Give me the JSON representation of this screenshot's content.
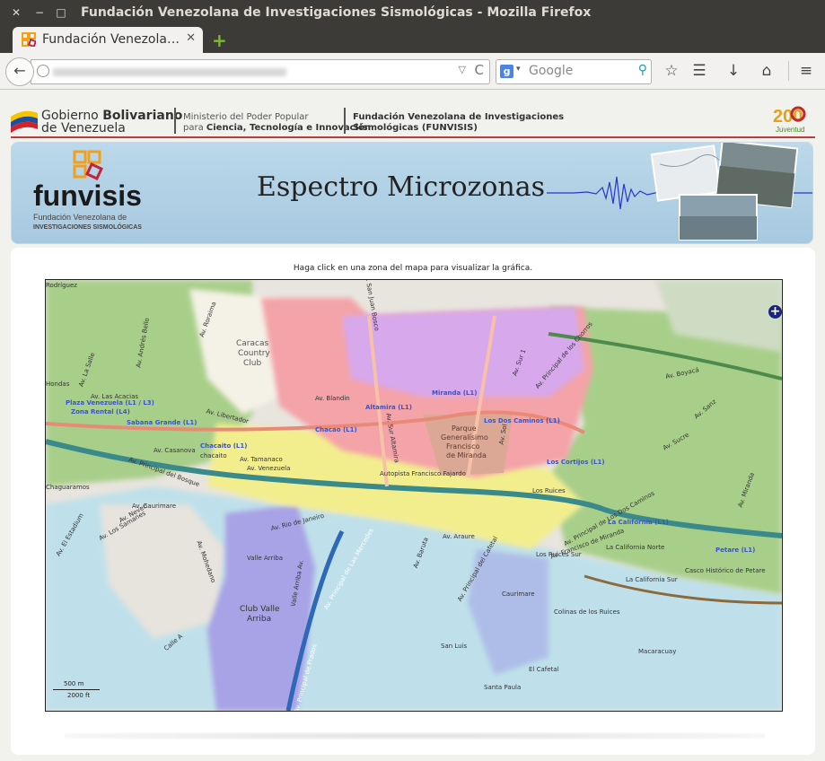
{
  "window": {
    "title": "Fundación Venezolana de Investigaciones Sismológicas - Mozilla Firefox",
    "close_glyph": "✕",
    "minimize_glyph": "−",
    "maximize_glyph": "□"
  },
  "tabs": [
    {
      "title": "Fundación Venezola…",
      "close_glyph": "✕",
      "icon": "funvisis-favicon"
    }
  ],
  "new_tab_glyph": "+",
  "navbar": {
    "back_glyph": "←",
    "url_dropdown_glyph": "▽",
    "reload_glyph": "C",
    "search_engine_letter": "g",
    "search_caret": "▾",
    "search_placeholder": "Google",
    "search_go_glyph": "⚲",
    "icons": [
      "star-icon",
      "reading-list-icon",
      "download-icon",
      "home-icon",
      "menu-icon"
    ],
    "icon_glyphs": {
      "star": "☆",
      "reading_list": "☰",
      "download": "↓",
      "home": "⌂",
      "menu": "≡"
    }
  },
  "gov_header": {
    "line1_a": "Gobierno ",
    "line1_b": "Bolivariano",
    "line2": "de Venezuela",
    "ministry_line1": "Ministerio del Poder Popular",
    "ministry_line2_a": "para ",
    "ministry_line2_b": "Ciencia, Tecnología e Innovación",
    "foundation_line1": "Fundación Venezolana de Investigaciones",
    "foundation_line2": "Sismológicas (FUNVISIS)",
    "juventud_number": "200",
    "juventud_text": "Juventud"
  },
  "banner": {
    "logo_word": "funvisis",
    "logo_sub1": "Fundación Venezolana de",
    "logo_sub2": "INVESTIGACIONES SISMOLÓGICAS",
    "title": "Espectro Microzonas"
  },
  "content": {
    "instructions": "Haga click en una zona del mapa para visualizar la gráfica."
  },
  "map": {
    "zoom_glyph": "+",
    "scale_metric": "500 m",
    "scale_imperial": "2000 ft",
    "colors": {
      "water_blue": "#bfe0ea",
      "green_zone": "#a8cf8a",
      "pink_zone": "#f4a3a8",
      "purple_zone": "#d7a8ec",
      "yellow_zone": "#f2ee8e",
      "violet_zone": "#a8a2e6",
      "gray_zone": "#e7e3dd"
    },
    "labels": [
      {
        "text": "Caracas",
        "cls": "place"
      },
      {
        "text": "Country",
        "cls": "place"
      },
      {
        "text": "Club",
        "cls": "place"
      },
      {
        "text": "Parque",
        "cls": "park"
      },
      {
        "text": "Generalísimo",
        "cls": "park"
      },
      {
        "text": "Francisco",
        "cls": "park"
      },
      {
        "text": "de Miranda",
        "cls": "park"
      },
      {
        "text": "Club Valle",
        "cls": "place"
      },
      {
        "text": "Arriba",
        "cls": "place"
      },
      {
        "text": "Altamira (L1)",
        "cls": "metro"
      },
      {
        "text": "Miranda (L1)",
        "cls": "metro"
      },
      {
        "text": "Los Dos Caminos (L1)",
        "cls": "metro"
      },
      {
        "text": "Chacao (L1)",
        "cls": "metro"
      },
      {
        "text": "Chacaito (L1)",
        "cls": "metro"
      },
      {
        "text": "Sabana Grande (L1)",
        "cls": "metro"
      },
      {
        "text": "Plaza Venezuela (L1 / L3)",
        "cls": "metro"
      },
      {
        "text": "Zona Rental (L4)",
        "cls": "metro"
      },
      {
        "text": "Los Cortijos (L1)",
        "cls": "metro"
      },
      {
        "text": "La California (L1)",
        "cls": "metro"
      },
      {
        "text": "Petare (L1)",
        "cls": "metro"
      },
      {
        "text": "Av. Blandin",
        "cls": "road"
      },
      {
        "text": "Av. Libertador",
        "cls": "road"
      },
      {
        "text": "Av. Tamanaco",
        "cls": "road"
      },
      {
        "text": "Av. Venezuela",
        "cls": "road"
      },
      {
        "text": "Av. Casanova",
        "cls": "road"
      },
      {
        "text": "Av. Boyacá",
        "cls": "road"
      },
      {
        "text": "Av. Sucre",
        "cls": "road"
      },
      {
        "text": "Av. Rio de Janeiro",
        "cls": "road"
      },
      {
        "text": "Av. Araure",
        "cls": "road"
      },
      {
        "text": "Av. Principal del Cafetal",
        "cls": "road"
      },
      {
        "text": "Autopista Francisco Fajardo",
        "cls": "road"
      },
      {
        "text": "Los Ruices",
        "cls": "place"
      },
      {
        "text": "Los Ruices Sur",
        "cls": "place"
      },
      {
        "text": "La California Norte",
        "cls": "place"
      },
      {
        "text": "La California Sur",
        "cls": "place"
      },
      {
        "text": "Casco Histórico de Petare",
        "cls": "place"
      },
      {
        "text": "Caurimare",
        "cls": "place"
      },
      {
        "text": "Colinas de los Ruices",
        "cls": "place"
      },
      {
        "text": "San Luis",
        "cls": "place"
      },
      {
        "text": "El Cafetal",
        "cls": "place"
      },
      {
        "text": "Santa Paula",
        "cls": "place"
      },
      {
        "text": "Macaracuay",
        "cls": "place"
      },
      {
        "text": "chacaito",
        "cls": "place"
      },
      {
        "text": "Chaguaramos",
        "cls": "place"
      },
      {
        "text": "Av. San Juan Bosco",
        "cls": "road"
      },
      {
        "text": "Av. Principal de los Chorros",
        "cls": "road"
      },
      {
        "text": "Av. Sur 1",
        "cls": "road"
      },
      {
        "text": "Av. Sur Altamira",
        "cls": "road"
      },
      {
        "text": "Av. Principal del Bosque",
        "cls": "road"
      },
      {
        "text": "Av. Roraima",
        "cls": "road"
      },
      {
        "text": "Av. Neveri",
        "cls": "road"
      },
      {
        "text": "Av. El Estadium",
        "cls": "road"
      },
      {
        "text": "Av. La Salle",
        "cls": "road"
      },
      {
        "text": "Av. Las Acacias",
        "cls": "road"
      },
      {
        "text": "Calle A",
        "cls": "road"
      },
      {
        "text": "Av. Los Samanes",
        "cls": "road"
      },
      {
        "text": "Av. Principal de Prados",
        "cls": "road"
      },
      {
        "text": "Av. Principal de Las Mercedes",
        "cls": "road"
      },
      {
        "text": "Valle Arriba",
        "cls": "road"
      },
      {
        "text": "Av. Caurimare",
        "cls": "road"
      },
      {
        "text": "Av. Sanz",
        "cls": "road"
      },
      {
        "text": "Av. Miranda",
        "cls": "road"
      },
      {
        "text": "Av. Andrés Bello",
        "cls": "road"
      },
      {
        "text": "Av. Francisco de Miranda",
        "cls": "road"
      },
      {
        "text": "Valle Arriba Av.",
        "cls": "road"
      },
      {
        "text": "Av. Mohedano",
        "cls": "road"
      },
      {
        "text": "Hondas",
        "cls": "road"
      },
      {
        "text": "Av. Sol",
        "cls": "road"
      },
      {
        "text": "Rodríguez",
        "cls": "road"
      },
      {
        "text": "Av. Principal de Los Dos Caminos",
        "cls": "road"
      },
      {
        "text": "Av. Baruta",
        "cls": "road"
      }
    ]
  }
}
